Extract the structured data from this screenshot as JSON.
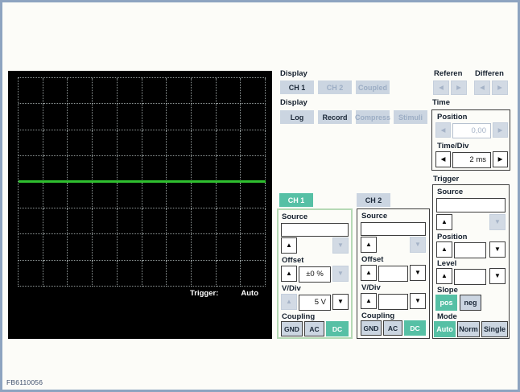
{
  "frame": {
    "figure_id": "FB6110056"
  },
  "colors": {
    "accent_teal": "#56c0a5",
    "button_gray": "#cbd5e1",
    "trace_green": "#2fbf2f",
    "frame_border": "#8ea4c0"
  },
  "icons": {
    "up": "▲",
    "down": "▼",
    "left": "◀",
    "right": "▶"
  },
  "scope": {
    "grid": {
      "cols": 10,
      "rows": 8
    },
    "trigger_label": "Trigger:",
    "trigger_value": "Auto"
  },
  "display_channels": {
    "label": "Display",
    "buttons": [
      {
        "label": "CH 1",
        "enabled": true
      },
      {
        "label": "CH 2",
        "enabled": false
      },
      {
        "label": "Coupled",
        "enabled": false
      }
    ]
  },
  "display_modes": {
    "label": "Display",
    "buttons": [
      {
        "label": "Log",
        "enabled": true
      },
      {
        "label": "Record",
        "enabled": true
      },
      {
        "label": "Compress",
        "enabled": false
      },
      {
        "label": "Stimuli",
        "enabled": false
      }
    ]
  },
  "reference": {
    "label": "Referen"
  },
  "difference": {
    "label": "Differen"
  },
  "time": {
    "label": "Time",
    "position": {
      "label": "Position",
      "value": "0,00"
    },
    "time_div": {
      "label": "Time/Div",
      "value": "2 ms"
    }
  },
  "ch1": {
    "tab_label": "CH 1",
    "source": {
      "label": "Source",
      "value": ""
    },
    "offset": {
      "label": "Offset",
      "value": "±0 %"
    },
    "vdiv": {
      "label": "V/Div",
      "value": "5 V"
    },
    "coupling": {
      "label": "Coupling",
      "options": [
        "GND",
        "AC",
        "DC"
      ],
      "selected": "DC"
    }
  },
  "ch2": {
    "tab_label": "CH 2",
    "source": {
      "label": "Source",
      "value": ""
    },
    "offset": {
      "label": "Offset",
      "value": ""
    },
    "vdiv": {
      "label": "V/Div",
      "value": ""
    },
    "coupling": {
      "label": "Coupling",
      "options": [
        "GND",
        "AC",
        "DC"
      ],
      "selected": "DC"
    }
  },
  "trigger": {
    "label": "Trigger",
    "source": {
      "label": "Source",
      "value": ""
    },
    "position": {
      "label": "Position",
      "value": ""
    },
    "level": {
      "label": "Level",
      "value": ""
    },
    "slope": {
      "label": "Slope",
      "options": [
        "pos",
        "neg"
      ],
      "selected": "pos"
    },
    "mode": {
      "label": "Mode",
      "options": [
        "Auto",
        "Norm",
        "Single"
      ],
      "selected": "Auto"
    }
  }
}
